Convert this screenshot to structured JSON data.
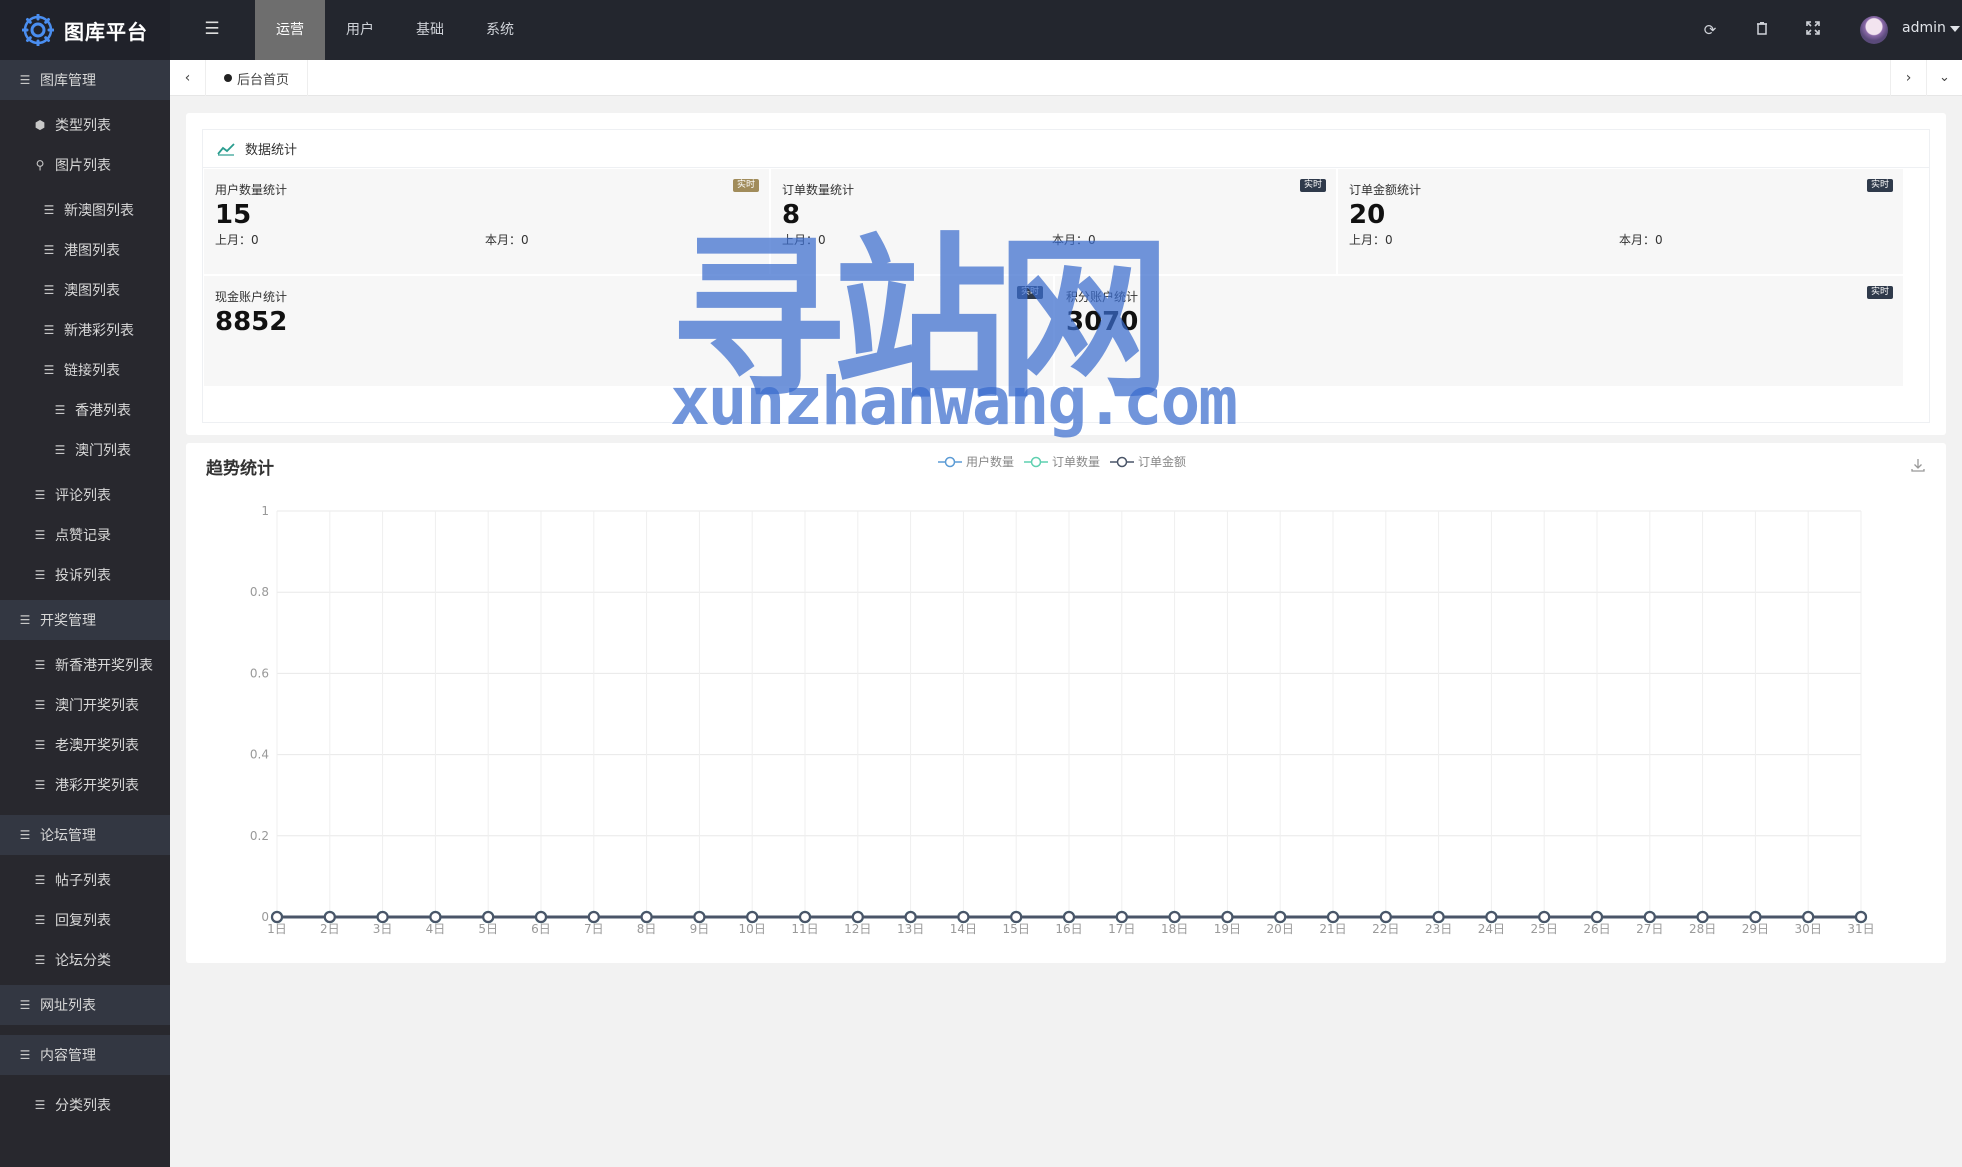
{
  "app": {
    "title": "图库平台"
  },
  "topnav": [
    {
      "label": "运营",
      "active": true
    },
    {
      "label": "用户",
      "active": false
    },
    {
      "label": "基础",
      "active": false
    },
    {
      "label": "系统",
      "active": false
    }
  ],
  "toolbar_icons": [
    "refresh-icon",
    "trash-icon",
    "fullscreen-icon"
  ],
  "user": {
    "name": "admin"
  },
  "sidebar": {
    "items": [
      {
        "label": "图库管理",
        "level": 0,
        "icon": "menu-icon"
      },
      {
        "label": "类型列表",
        "level": 1,
        "icon": "cube-icon"
      },
      {
        "label": "图片列表",
        "level": 1,
        "icon": "search-icon"
      },
      {
        "label": "新澳图列表",
        "level": 2,
        "icon": "list-icon"
      },
      {
        "label": "港图列表",
        "level": 2,
        "icon": "list-icon"
      },
      {
        "label": "澳图列表",
        "level": 2,
        "icon": "list-icon"
      },
      {
        "label": "新港彩列表",
        "level": 2,
        "icon": "list-icon"
      },
      {
        "label": "链接列表",
        "level": 2,
        "icon": "list-icon"
      },
      {
        "label": "香港列表",
        "level": 3,
        "icon": "list-icon"
      },
      {
        "label": "澳门列表",
        "level": 3,
        "icon": "list-icon"
      },
      {
        "label": "评论列表",
        "level": 1,
        "icon": "list-icon"
      },
      {
        "label": "点赞记录",
        "level": 1,
        "icon": "list-icon"
      },
      {
        "label": "投诉列表",
        "level": 1,
        "icon": "list-icon"
      },
      {
        "label": "开奖管理",
        "level": 0,
        "icon": "list-icon"
      },
      {
        "label": "新香港开奖列表",
        "level": 1,
        "icon": "list-icon"
      },
      {
        "label": "澳门开奖列表",
        "level": 1,
        "icon": "list-icon"
      },
      {
        "label": "老澳开奖列表",
        "level": 1,
        "icon": "list-icon"
      },
      {
        "label": "港彩开奖列表",
        "level": 1,
        "icon": "list-icon"
      },
      {
        "label": "论坛管理",
        "level": 0,
        "icon": "list-icon"
      },
      {
        "label": "帖子列表",
        "level": 1,
        "icon": "list-icon"
      },
      {
        "label": "回复列表",
        "level": 1,
        "icon": "list-icon"
      },
      {
        "label": "论坛分类",
        "level": 1,
        "icon": "list-icon"
      },
      {
        "label": "网址列表",
        "level": 0,
        "icon": "list-icon"
      },
      {
        "label": "内容管理",
        "level": 0,
        "icon": "list-icon"
      },
      {
        "label": "分类列表",
        "level": 1,
        "icon": "list-icon"
      }
    ]
  },
  "tabs": {
    "home": "后台首页"
  },
  "stats": {
    "title": "数据统计",
    "badge": "实时",
    "cards": [
      {
        "label": "用户数量统计",
        "value": "15",
        "last_month": "上月：0",
        "this_month": "本月：0",
        "badge_color": "#a18c5b"
      },
      {
        "label": "订单数量统计",
        "value": "8",
        "last_month": "上月：0",
        "this_month": "本月：0",
        "badge_color": "#2f3a4b"
      },
      {
        "label": "订单金额统计",
        "value": "20",
        "last_month": "上月：0",
        "this_month": "本月：0",
        "badge_color": "#2f3a4b"
      },
      {
        "label": "现金账户统计",
        "value": "8852",
        "badge_color": "#2f3a4b"
      },
      {
        "label": "积分账户统计",
        "value": "3070",
        "badge_color": "#2f3a4b"
      }
    ]
  },
  "trend": {
    "title": "趋势统计"
  },
  "chart_data": {
    "type": "line",
    "title": "趋势统计",
    "x": [
      "1日",
      "2日",
      "3日",
      "4日",
      "5日",
      "6日",
      "7日",
      "8日",
      "9日",
      "10日",
      "11日",
      "12日",
      "13日",
      "14日",
      "15日",
      "16日",
      "17日",
      "18日",
      "19日",
      "20日",
      "21日",
      "22日",
      "23日",
      "24日",
      "25日",
      "26日",
      "27日",
      "28日",
      "29日",
      "30日",
      "31日"
    ],
    "ylim": [
      0,
      1
    ],
    "yticks": [
      "0",
      "0.2",
      "0.4",
      "0.6",
      "0.8",
      "1"
    ],
    "grid": true,
    "legend": "top-center",
    "series": [
      {
        "name": "用户数量",
        "color": "#5b9bd5",
        "values": [
          0,
          0,
          0,
          0,
          0,
          0,
          0,
          0,
          0,
          0,
          0,
          0,
          0,
          0,
          0,
          0,
          0,
          0,
          0,
          0,
          0,
          0,
          0,
          0,
          0,
          0,
          0,
          0,
          0,
          0,
          0
        ]
      },
      {
        "name": "订单数量",
        "color": "#5fd0b0",
        "values": [
          0,
          0,
          0,
          0,
          0,
          0,
          0,
          0,
          0,
          0,
          0,
          0,
          0,
          0,
          0,
          0,
          0,
          0,
          0,
          0,
          0,
          0,
          0,
          0,
          0,
          0,
          0,
          0,
          0,
          0,
          0
        ]
      },
      {
        "name": "订单金额",
        "color": "#4a5568",
        "values": [
          0,
          0,
          0,
          0,
          0,
          0,
          0,
          0,
          0,
          0,
          0,
          0,
          0,
          0,
          0,
          0,
          0,
          0,
          0,
          0,
          0,
          0,
          0,
          0,
          0,
          0,
          0,
          0,
          0,
          0,
          0
        ]
      }
    ]
  },
  "watermark": {
    "text": "寻站网",
    "url": "xunzhanwang.com",
    "color": "#3a6ccd"
  }
}
